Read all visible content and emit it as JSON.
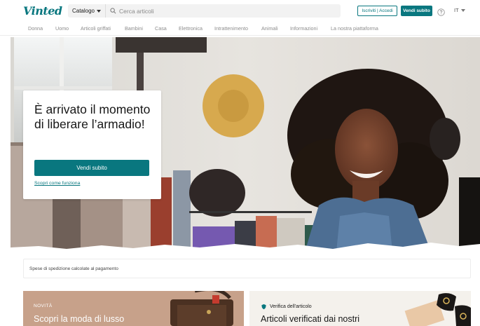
{
  "header": {
    "logo": "Vinted",
    "catalog_label": "Catalogo",
    "search_placeholder": "Cerca articoli",
    "login_label": "Iscriviti | Accedi",
    "sell_label": "Vendi subito",
    "language": "IT"
  },
  "nav": {
    "items": [
      "Donna",
      "Uomo",
      "Articoli griffati",
      "Bambini",
      "Casa",
      "Elettronica",
      "Intrattenimento",
      "Animali",
      "Informazioni",
      "La nostra piattaforma"
    ]
  },
  "hero": {
    "title": "È arrivato il momento di liberare l’armadio!",
    "button": "Vendi subito",
    "link": "Scopri come funziona"
  },
  "shipping": {
    "text": "Spese di spedizione calcolate al pagamento"
  },
  "tiles": {
    "left": {
      "kicker": "NOVITÀ",
      "title": "Scopri la moda di lusso"
    },
    "right": {
      "kicker": "Verifica dell'articolo",
      "title": "Articoli verificati dai nostri"
    }
  },
  "colors": {
    "brand": "#09777f",
    "tile_left_bg": "#c7a18a",
    "tile_right_bg": "#f4f1ec"
  }
}
